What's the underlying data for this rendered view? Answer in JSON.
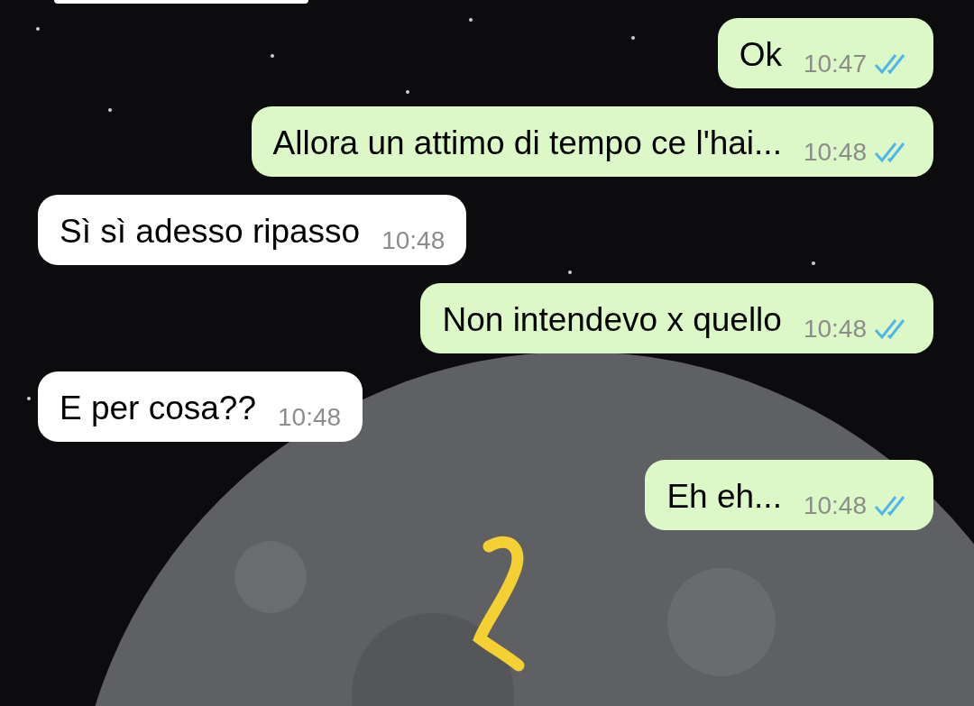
{
  "messages": [
    {
      "kind": "out",
      "text": "Ok",
      "time": "10:47",
      "read": true
    },
    {
      "kind": "out",
      "text": "Allora un attimo di tempo ce l'hai...",
      "time": "10:48",
      "read": true
    },
    {
      "kind": "in",
      "text": "Sì sì adesso ripasso",
      "time": "10:48"
    },
    {
      "kind": "out",
      "text": "Non intendevo x quello",
      "time": "10:48",
      "read": true
    },
    {
      "kind": "in",
      "text": "E per cosa??",
      "time": "10:48"
    },
    {
      "kind": "out",
      "text": "Eh eh...",
      "time": "10:48",
      "read": true
    }
  ]
}
